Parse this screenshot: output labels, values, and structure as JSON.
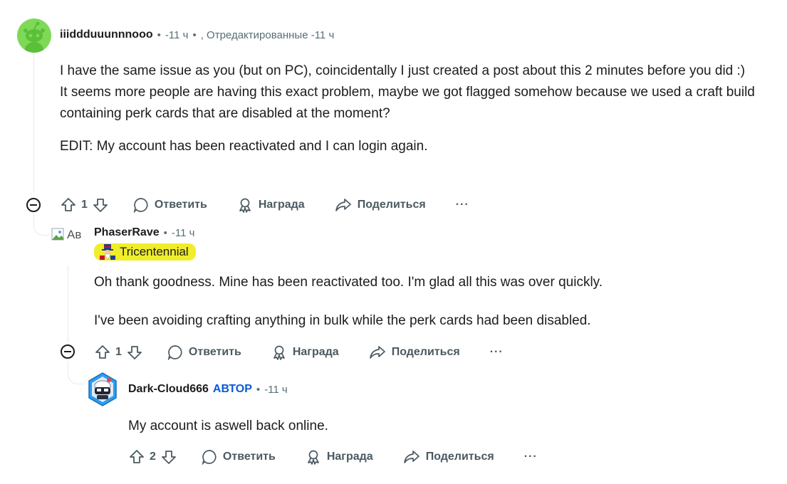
{
  "comments": [
    {
      "author": "iiiddduuunnnooo",
      "time": "-11 ч",
      "edited": ", Отредактированные -11 ч",
      "paragraphs": [
        "I have the same issue as you (but on PC), coincidentally I just created a post about this 2 minutes before you did :)",
        "It seems more people are having this exact problem, maybe we got flagged somehow because we used a craft build containing perk cards that are disabled at the moment?",
        "EDIT: My account has been reactivated and I can login again."
      ],
      "votes": "1"
    },
    {
      "author": "PhaserRave",
      "avatar_alt": "Ав",
      "time": "-11 ч",
      "flair": "Tricentennial",
      "paragraphs": [
        "Oh thank goodness. Mine has been reactivated too. I'm glad all this was over quickly.",
        "I've been avoiding crafting anything in bulk while the perk cards had been disabled."
      ],
      "votes": "1"
    },
    {
      "author": "Dark-Cloud666",
      "op_tag": "АВТОР",
      "time": "-11 ч",
      "paragraphs": [
        "My account is aswell back online."
      ],
      "votes": "2"
    }
  ],
  "actions": {
    "reply": "Ответить",
    "award": "Награда",
    "share": "Поделиться",
    "more": "···"
  },
  "separator": "•",
  "colors": {
    "meta": "#576f76",
    "op": "#0a5ad6",
    "flair_bg": "#f0ed2a",
    "avatar_green": "#7ed957"
  }
}
